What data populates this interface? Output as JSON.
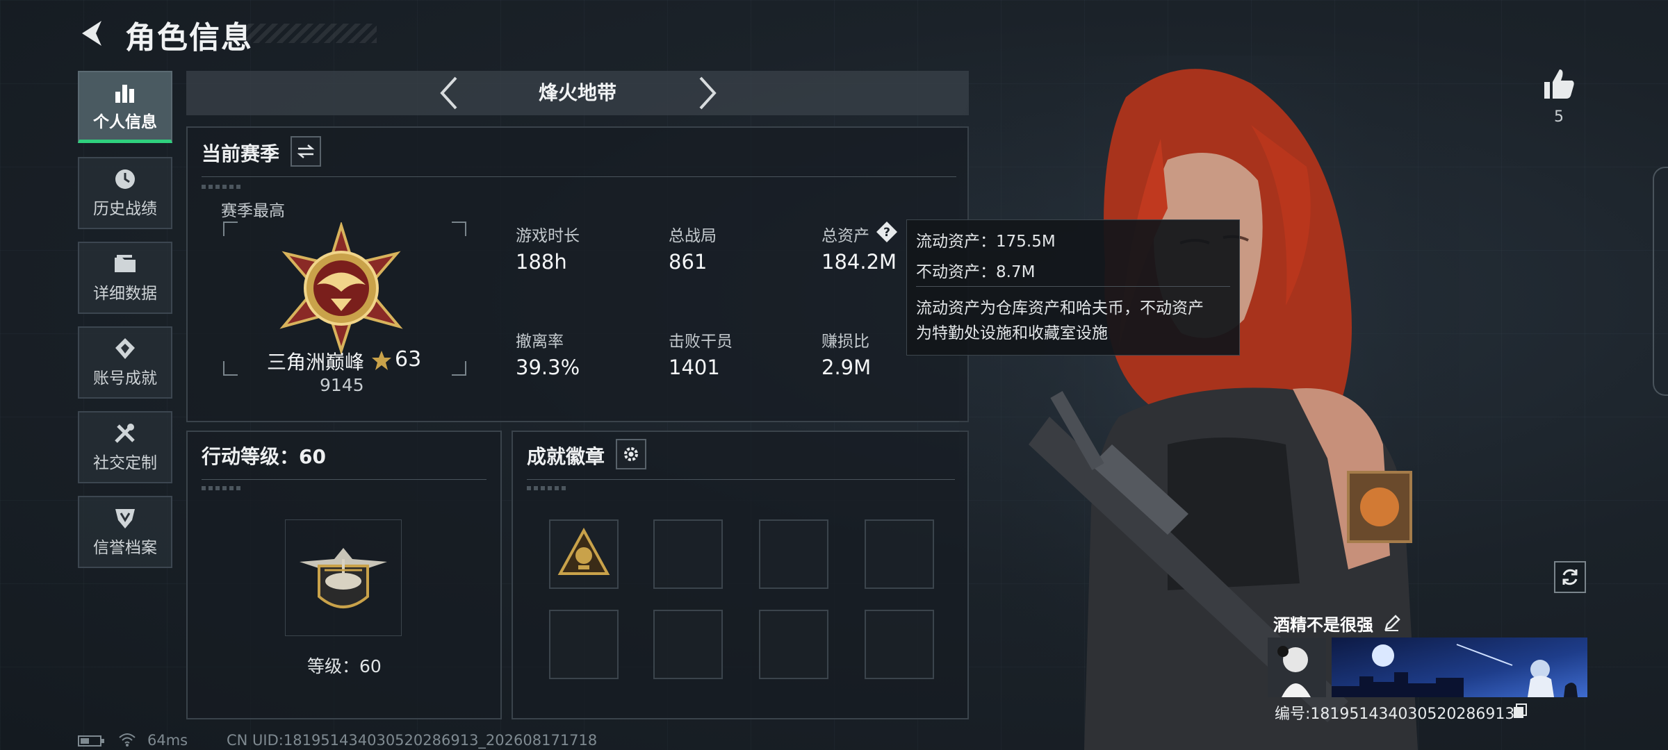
{
  "header": {
    "title": "角色信息",
    "back_icon": "back-arrow-icon"
  },
  "sidebar": {
    "items": [
      {
        "label": "个人信息",
        "icon": "bar-chart-icon",
        "active": true
      },
      {
        "label": "历史战绩",
        "icon": "clock-icon"
      },
      {
        "label": "详细数据",
        "icon": "folder-icon"
      },
      {
        "label": "账号成就",
        "icon": "medal-icon"
      },
      {
        "label": "社交定制",
        "icon": "tools-icon"
      },
      {
        "label": "信誉档案",
        "icon": "shield-icon"
      }
    ]
  },
  "mode_selector": {
    "title": "烽火地带"
  },
  "season": {
    "title": "当前赛季",
    "best_label": "赛季最高",
    "rank_name": "三角洲巅峰",
    "rank_stars": "63",
    "rank_points": "9145",
    "stats": [
      {
        "label": "游戏时长",
        "value": "188h"
      },
      {
        "label": "总战局",
        "value": "861"
      },
      {
        "label": "总资产",
        "value": "184.2M"
      },
      {
        "label": "撤离率",
        "value": "39.3%"
      },
      {
        "label": "击败干员",
        "value": "1401"
      },
      {
        "label": "赚损比",
        "value": "2.9M"
      }
    ]
  },
  "tooltip": {
    "liquid": "流动资产：175.5M",
    "fixed": "不动资产：8.7M",
    "desc_line1": "流动资产为仓库资产和哈夫币，不动资产",
    "desc_line2": "为特勤处设施和收藏室设施"
  },
  "action_level": {
    "title": "行动等级：60",
    "level_text": "等级：60"
  },
  "achievements": {
    "title": "成就徽章",
    "filled_slots": 1,
    "total_slots": 8
  },
  "likes": {
    "count": "5"
  },
  "player": {
    "name": "酒精不是很强",
    "id_text": "编号:181951434030520286913"
  },
  "status_bar": {
    "ping": "64ms",
    "uid": "CN UID:181951434030520286913_202608171718"
  },
  "colors": {
    "accent_green": "#2fd07e",
    "gold": "#c9a24a",
    "hair": "#c0391f"
  }
}
